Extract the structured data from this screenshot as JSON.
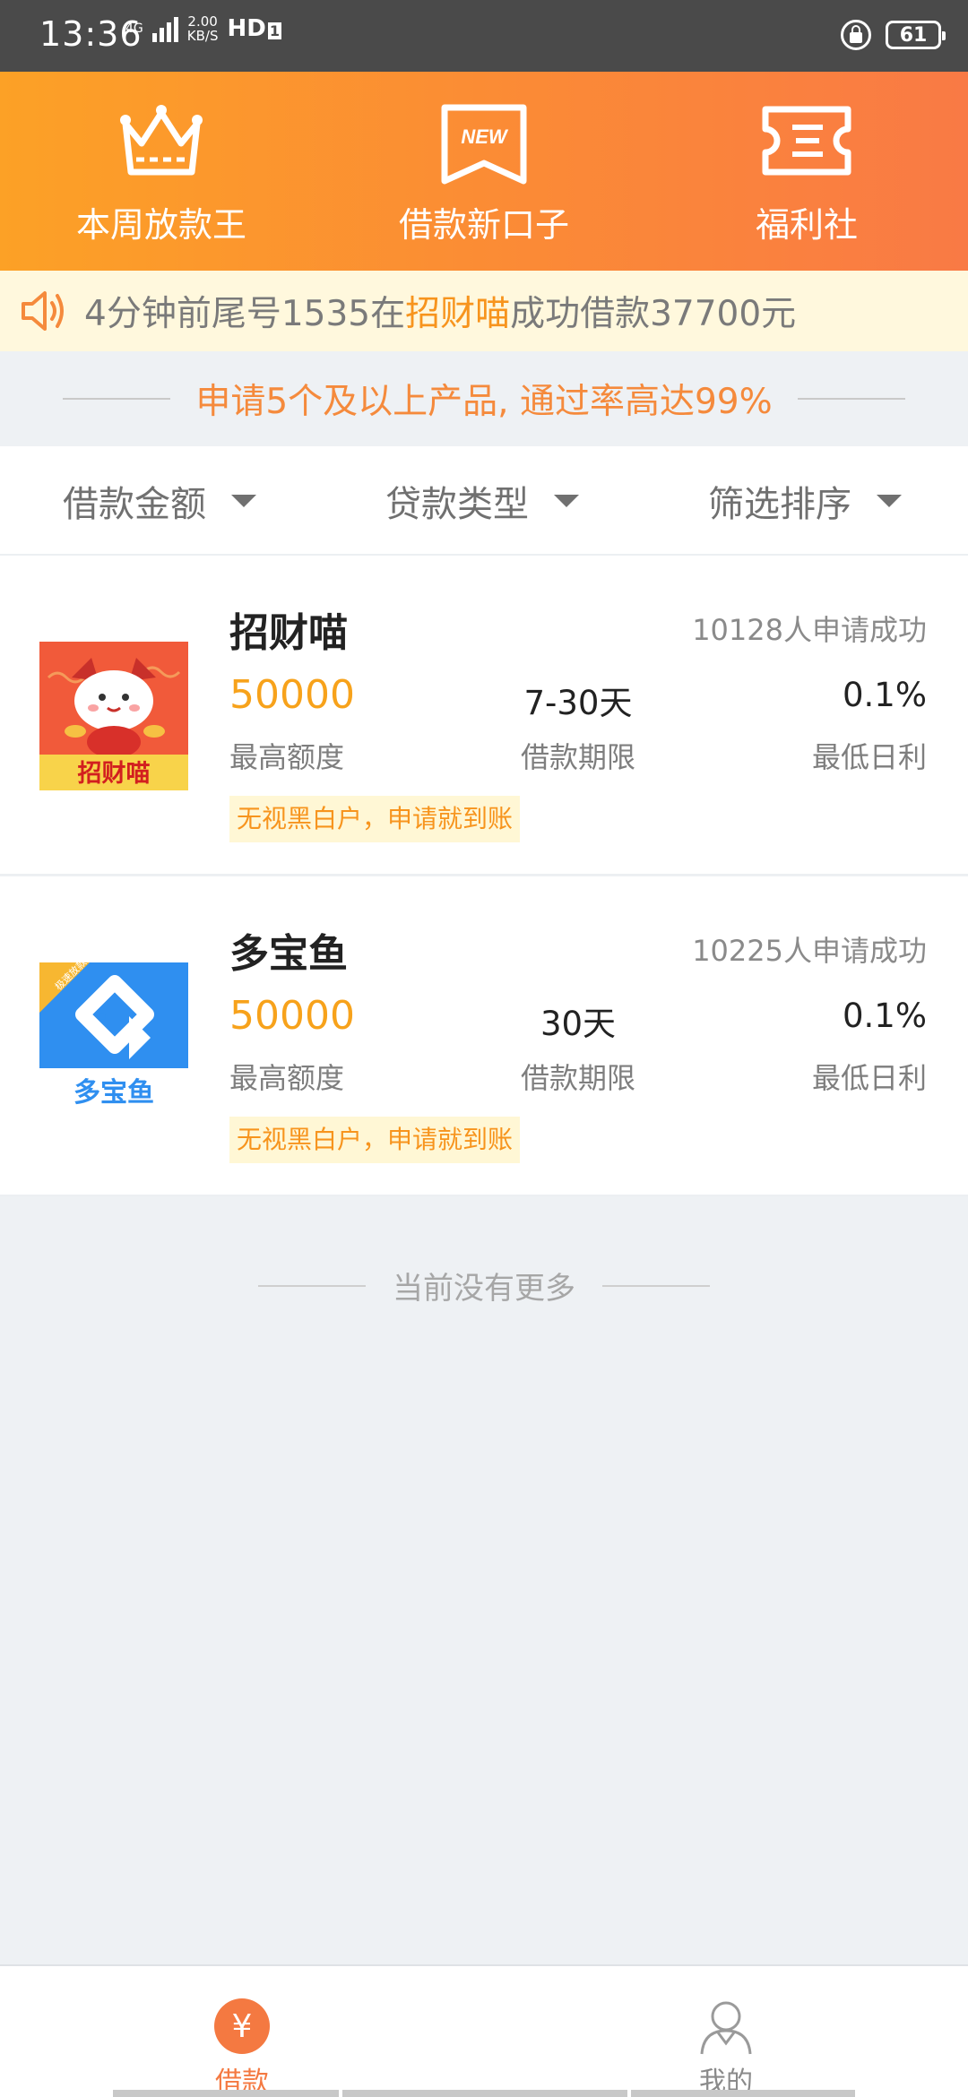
{
  "status_bar": {
    "time": "13:36",
    "network": "4G",
    "speed_value": "2.00",
    "speed_unit": "KB/S",
    "hd": "HD",
    "hd_index": "1",
    "battery": "61"
  },
  "header": {
    "items": [
      {
        "label": "本周放款王",
        "icon": "crown-icon"
      },
      {
        "label": "借款新口子",
        "icon": "new-badge-icon",
        "badge_text": "NEW"
      },
      {
        "label": "福利社",
        "icon": "coupon-icon"
      }
    ]
  },
  "notice": {
    "prefix": "4分钟前尾号1535在",
    "highlight": "招财喵",
    "suffix": "成功借款37700元"
  },
  "promo": {
    "text": "申请5个及以上产品, 通过率高达99%"
  },
  "filters": [
    {
      "label": "借款金额"
    },
    {
      "label": "贷款类型"
    },
    {
      "label": "筛选排序"
    }
  ],
  "products": [
    {
      "name": "招财喵",
      "applied": "10128人申请成功",
      "amount": "50000",
      "amount_label": "最高额度",
      "term": "7-30天",
      "term_label": "借款期限",
      "rate": "0.1%",
      "rate_label": "最低日利",
      "tag": "无视黑白户，申请就到账",
      "logo_text": "招财喵"
    },
    {
      "name": "多宝鱼",
      "applied": "10225人申请成功",
      "amount": "50000",
      "amount_label": "最高额度",
      "term": "30天",
      "term_label": "借款期限",
      "rate": "0.1%",
      "rate_label": "最低日利",
      "tag": "无视黑白户，申请就到账",
      "logo_text": "多宝鱼",
      "logo_ribbon": "极速放款"
    }
  ],
  "list_end": "当前没有更多",
  "bottom_nav": [
    {
      "label": "借款",
      "icon": "yen-icon",
      "active": true
    },
    {
      "label": "我的",
      "icon": "user-icon",
      "active": false
    }
  ],
  "colors": {
    "accent": "#f7941d",
    "header_start": "#fca126",
    "header_end": "#f97a45",
    "amount": "#f7a21b",
    "nav_active": "#f47941"
  }
}
